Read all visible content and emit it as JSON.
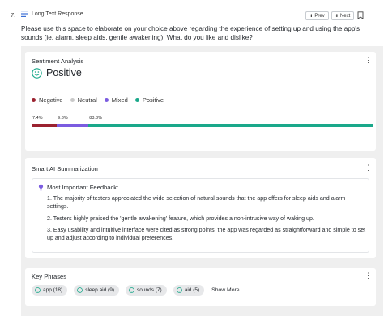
{
  "question": {
    "number": "7.",
    "type_label": "Long Text Response",
    "type_icon": "lines-icon",
    "prev_label": "Prev",
    "next_label": "Next",
    "prev_arrow": "⬆",
    "next_arrow": "⬇",
    "text": "Please use this space to elaborate on your choice above regarding the experience of setting up and using the app's sounds (ie. alarm, sleep aids, gentle awakening). What do you like and dislike?"
  },
  "sentiment": {
    "title": "Sentiment Analysis",
    "value": "Positive",
    "icon": "smiley-icon",
    "legend": [
      {
        "label": "Negative",
        "color": "#9b2230"
      },
      {
        "label": "Neutral",
        "color": "#c9c9c9"
      },
      {
        "label": "Mixed",
        "color": "#7b5ce0"
      },
      {
        "label": "Positive",
        "color": "#1aa88a"
      }
    ],
    "distribution": [
      {
        "label": "7.4%",
        "percent": 7.4,
        "color": "#9b2230"
      },
      {
        "label": "9.3%",
        "percent": 9.3,
        "color": "#7b5ce0"
      },
      {
        "label": "83.3%",
        "percent": 83.3,
        "color": "#1aa88a"
      }
    ]
  },
  "summary": {
    "title": "Smart AI Summarization",
    "heading": "Most Important Feedback:",
    "points": [
      "1. The majority of testers appreciated the wide selection of natural sounds that the app offers for sleep aids and alarm settings.",
      "2. Testers highly praised the 'gentle awakening' feature, which provides a non-intrusive way of waking up.",
      "3. Easy usability and intuitive interface were cited as strong points; the app was regarded as straightforward and simple to set up and adjust according to individual preferences."
    ]
  },
  "key_phrases": {
    "title": "Key Phrases",
    "chips": [
      "app (18)",
      "sleep aid (9)",
      "sounds (7)",
      "aid (5)"
    ],
    "show_more": "Show More"
  },
  "menu_glyph": "⋮"
}
